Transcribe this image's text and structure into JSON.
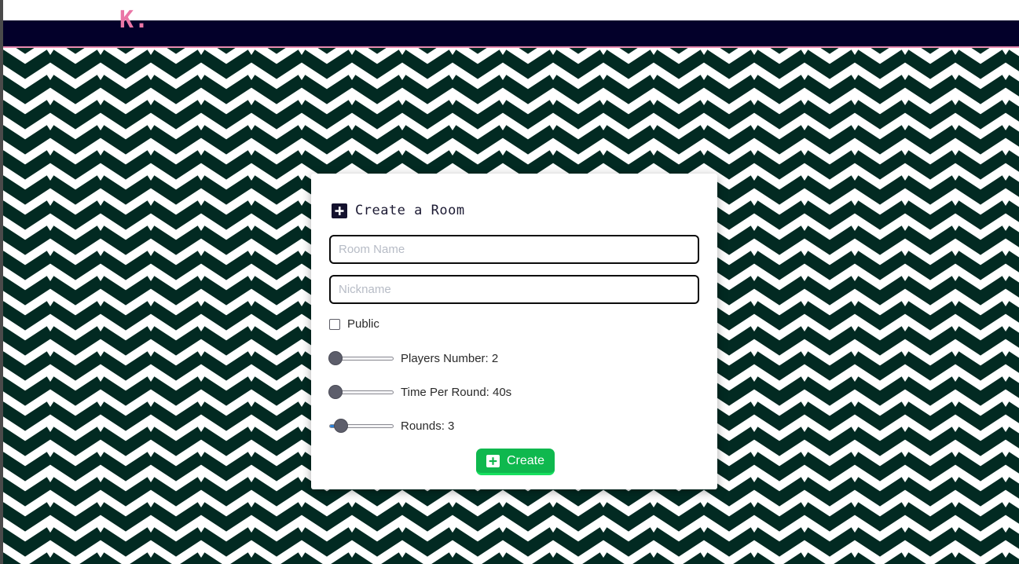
{
  "app": {
    "logo": "K."
  },
  "colors": {
    "navbar": "#03002a",
    "navbar_border": "#e98bb1",
    "logo": "#ea76a6",
    "pattern_dark": "#022a22",
    "pattern_light": "#ffffff",
    "button": "#0fb84e",
    "button_border": "#16e05f"
  },
  "create_room": {
    "title": "Create a Room",
    "title_icon": "plus-square-icon",
    "room_name": {
      "value": "",
      "placeholder": "Room Name"
    },
    "nickname": {
      "value": "",
      "placeholder": "Nickname"
    },
    "public": {
      "label": "Public",
      "checked": false
    },
    "players": {
      "label": "Players Number: 2",
      "value": 2,
      "fraction": 0
    },
    "time": {
      "label": "Time Per Round: 40s",
      "value": 40,
      "fraction": 0
    },
    "rounds": {
      "label": "Rounds: 3",
      "value": 3,
      "fraction": 0.1
    },
    "create_button": {
      "label": "Create",
      "icon": "plus-square-icon"
    }
  }
}
